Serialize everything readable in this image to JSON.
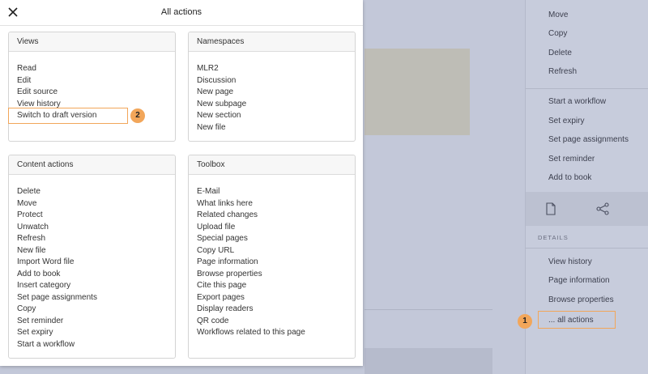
{
  "dialog": {
    "title": "All actions",
    "panels": {
      "views": {
        "title": "Views",
        "items": [
          "Read",
          "Edit",
          "Edit source",
          "View history",
          "Switch to draft version"
        ]
      },
      "namespaces": {
        "title": "Namespaces",
        "items": [
          "MLR2",
          "Discussion",
          "New page",
          "New subpage",
          "New section",
          "New file"
        ]
      },
      "content_actions": {
        "title": "Content actions",
        "items": [
          "Delete",
          "Move",
          "Protect",
          "Unwatch",
          "Refresh",
          "New file",
          "Import Word file",
          "Add to book",
          "Insert category",
          "Set page assignments",
          "Copy",
          "Set reminder",
          "Set expiry",
          "Start a workflow"
        ]
      },
      "toolbox": {
        "title": "Toolbox",
        "items": [
          "E-Mail",
          "What links here",
          "Related changes",
          "Upload file",
          "Special pages",
          "Copy URL",
          "Page information",
          "Browse properties",
          "Cite this page",
          "Export pages",
          "Display readers",
          "QR code",
          "Workflows related to this page"
        ]
      }
    }
  },
  "sidebar": {
    "group1": [
      "Move",
      "Copy",
      "Delete",
      "Refresh"
    ],
    "group2": [
      "Start a workflow",
      "Set expiry",
      "Set page assignments",
      "Set reminder",
      "Add to book"
    ],
    "details_heading": "DETAILS",
    "details": [
      "View history",
      "Page information",
      "Browse properties"
    ],
    "all_actions": "... all actions"
  },
  "callouts": {
    "one": "1",
    "two": "2"
  },
  "colors": {
    "highlight": "#f2a65a",
    "overlay": "#c3c8d9"
  }
}
